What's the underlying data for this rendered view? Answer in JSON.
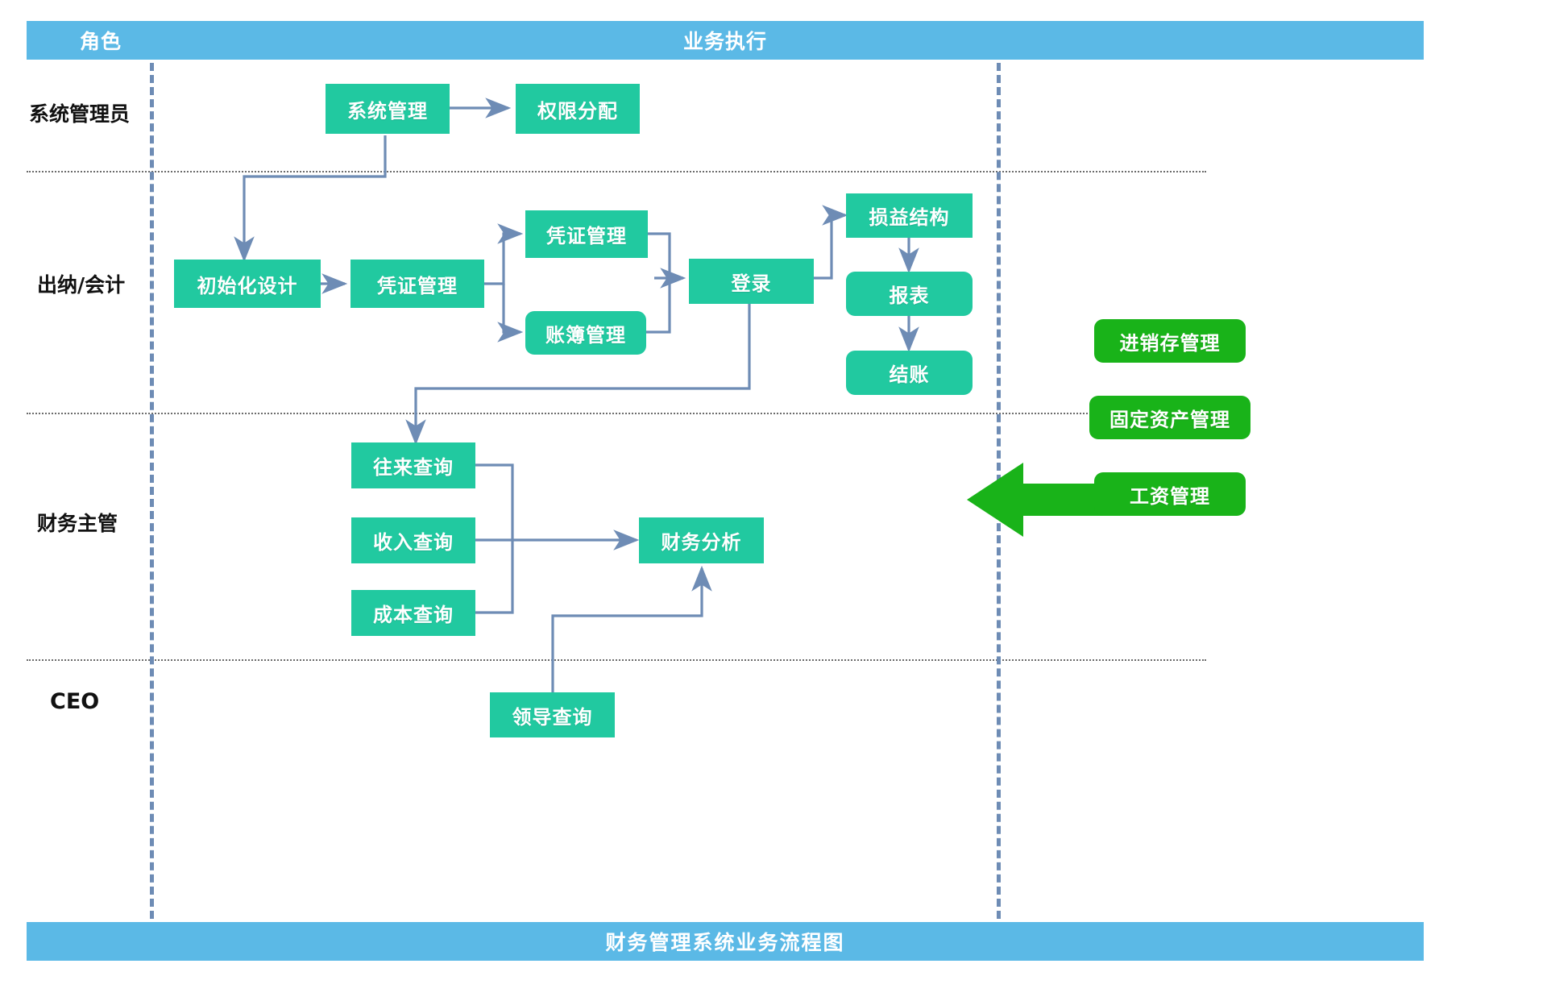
{
  "header": {
    "role_column_label": "角色",
    "execution_column_label": "业务执行"
  },
  "footer": {
    "title": "财务管理系统业务流程图"
  },
  "lanes": [
    {
      "id": "sysadmin",
      "label": "系统管理员"
    },
    {
      "id": "cashier",
      "label": "出纳/会计"
    },
    {
      "id": "supervisor",
      "label": "财务主管"
    },
    {
      "id": "ceo",
      "label": "CEO"
    }
  ],
  "nodes": {
    "system_management": "系统管理",
    "permission_assignment": "权限分配",
    "init_design": "初始化设计",
    "voucher_management_1": "凭证管理",
    "voucher_management_2": "凭证管理",
    "ledger_management": "账簿管理",
    "login": "登录",
    "profit_loss_structure": "损益结构",
    "report": "报表",
    "settlement": "结账",
    "transaction_query": "往来查询",
    "income_query": "收入查询",
    "cost_query": "成本查询",
    "financial_analysis": "财务分析",
    "leader_query": "领导查询"
  },
  "modules": [
    {
      "id": "inventory",
      "label": "进销存管理"
    },
    {
      "id": "fixed_assets",
      "label": "固定资产管理"
    },
    {
      "id": "payroll",
      "label": "工资管理"
    }
  ],
  "colors": {
    "banner_blue": "#5BB9E6",
    "node_green": "#21C9A0",
    "module_green": "#19B319",
    "connector_blue": "#6E8CB5",
    "lane_divider": "#6b6b6b"
  }
}
